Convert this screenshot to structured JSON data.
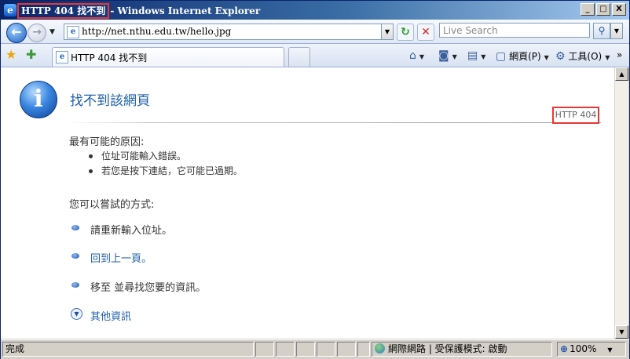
{
  "window": {
    "title_highlight": "HTTP 404 找不到",
    "title_suffix": " - Windows Internet Explorer",
    "minimize": "_",
    "maximize": "□",
    "close": "X"
  },
  "toolbar": {
    "address": "http://net.nthu.edu.tw/hello.jpg",
    "search_placeholder": "Live Search",
    "search_icon": "magnifier-icon"
  },
  "tabs": [
    {
      "label": "HTTP 404 找不到"
    }
  ],
  "commands": {
    "page_label": "網頁(P)",
    "tools_label": "工具(O)"
  },
  "page": {
    "title": "找不到該網頁",
    "code": "HTTP 404",
    "reasons_heading": "最有可能的原因:",
    "reasons": [
      "位址可能輸入錯誤。",
      "若您是按下連結，它可能已過期。"
    ],
    "try_heading": "您可以嘗試的方式:",
    "actions": [
      {
        "label": "請重新輸入位址。"
      },
      {
        "label": "回到上一頁。"
      },
      {
        "label": "移至  並尋找您要的資訊。"
      }
    ],
    "more_info": "其他資訊"
  },
  "status": {
    "text": "完成",
    "zone": "網際網路 | 受保護模式: 啟動",
    "zoom": "100%"
  },
  "colors": {
    "link": "#1f5fa8",
    "highlight_border": "#e53935",
    "title_bar": "#0a246a"
  }
}
